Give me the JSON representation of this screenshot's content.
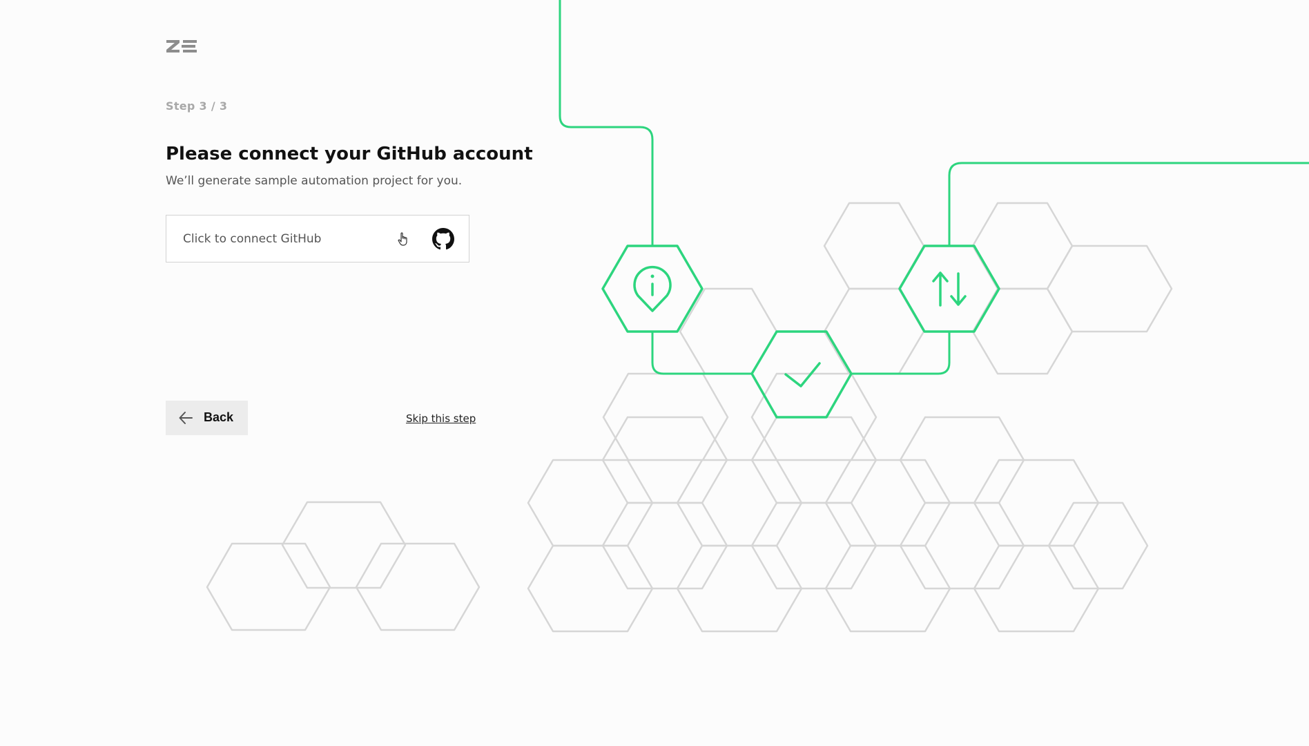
{
  "logo": {
    "text": "ZE",
    "icon": "ze-logo"
  },
  "step": {
    "label": "Step 3 / 3"
  },
  "heading": {
    "title": "Please connect your GitHub account",
    "subtitle": "We’ll generate sample automation project for you."
  },
  "connect": {
    "label": "Click to connect GitHub",
    "icon": "github-icon",
    "cursor_icon": "hand-pointer-icon"
  },
  "footer": {
    "back_label": "Back",
    "back_icon": "arrow-left-icon",
    "skip_label": "Skip this step"
  },
  "illustration": {
    "accent_color": "#2dd57e",
    "outline_color": "#d6d6d6",
    "icons": [
      "info-pin-icon",
      "checkmark-icon",
      "sort-arrows-icon"
    ]
  }
}
